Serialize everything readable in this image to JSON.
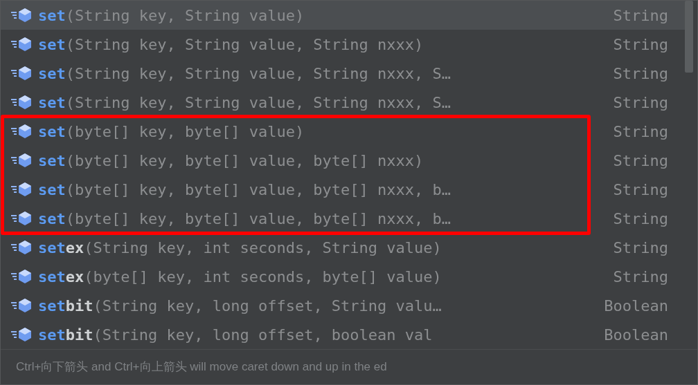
{
  "completion_list": {
    "items": [
      {
        "prefix": "set",
        "params": "(String key, String value)",
        "type": "String",
        "selected": true,
        "boxed": false
      },
      {
        "prefix": "set",
        "params": "(String key, String value, String nxxx)",
        "type": "String",
        "selected": false,
        "boxed": false
      },
      {
        "prefix": "set",
        "params": "(String key, String value, String nxxx, S…",
        "type": "String",
        "selected": false,
        "boxed": false
      },
      {
        "prefix": "set",
        "params": "(String key, String value, String nxxx, S…",
        "type": "String",
        "selected": false,
        "boxed": false
      },
      {
        "prefix": "set",
        "params": "(byte[] key, byte[] value)",
        "type": "String",
        "selected": false,
        "boxed": true
      },
      {
        "prefix": "set",
        "params": "(byte[] key, byte[] value, byte[] nxxx)",
        "type": "String",
        "selected": false,
        "boxed": true
      },
      {
        "prefix": "set",
        "params": "(byte[] key, byte[] value, byte[] nxxx, b…",
        "type": "String",
        "selected": false,
        "boxed": true
      },
      {
        "prefix": "set",
        "params": "(byte[] key, byte[] value, byte[] nxxx, b…",
        "type": "String",
        "selected": false,
        "boxed": true
      },
      {
        "prefix": "set",
        "rest": "ex",
        "params": "(String key, int seconds, String value)",
        "type": "String",
        "selected": false,
        "boxed": false
      },
      {
        "prefix": "set",
        "rest": "ex",
        "params": "(byte[] key, int seconds, byte[] value)",
        "type": "String",
        "selected": false,
        "boxed": false
      },
      {
        "prefix": "set",
        "rest": "bit",
        "params": "(String key, long offset, String valu…",
        "type": "Boolean",
        "selected": false,
        "boxed": false
      },
      {
        "prefix": "set",
        "rest": "bit",
        "params": "(String key, long offset, boolean val",
        "type": "Boolean",
        "selected": false,
        "boxed": false
      }
    ]
  },
  "hint": "Ctrl+向下箭头 and Ctrl+向上箭头 will move caret down and up in the ed"
}
